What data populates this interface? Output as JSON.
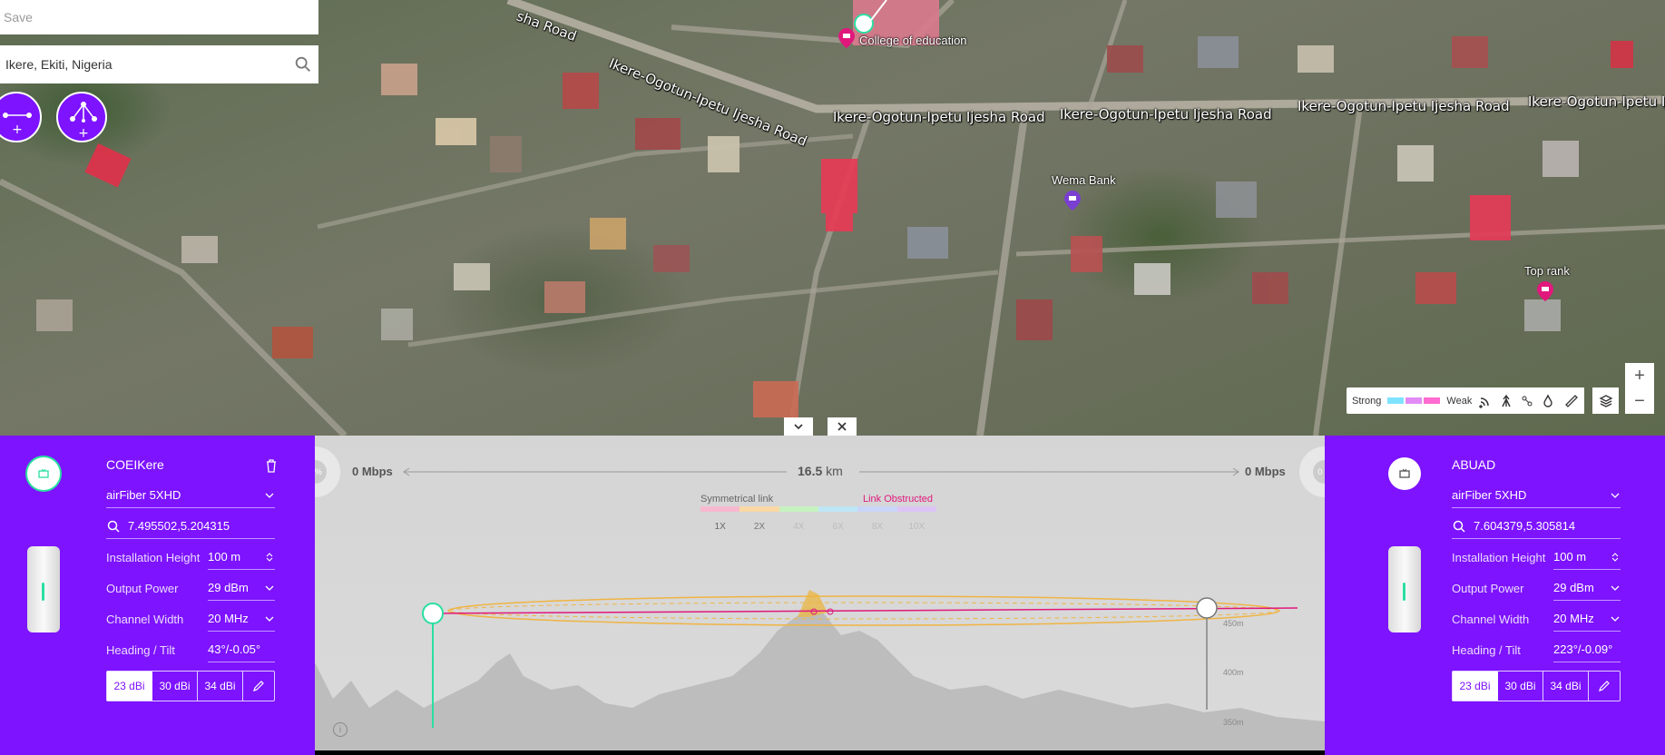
{
  "map": {
    "roads": [
      "Ikere-Ogotun-Ipetu Ijesha Road",
      "Ikere-Ogotun-Ipetu Ijesha Road",
      "Ikere-Ogotun-Ipetu Ijesha Road",
      "Ikere-Ogotun-Ipetu Ijesha Road",
      "Ikere-Ogotun-Ipetu Ijesha Road",
      "Ikere-Ogotun-Ipetu Ijesha Road",
      "sha Road"
    ],
    "pois": {
      "college": "College of education",
      "bank": "Wema Bank",
      "toprank": "Top rank"
    }
  },
  "toolbar": {
    "save_placeholder": "Save",
    "search_value": "Ikere, Ekiti, Nigeria"
  },
  "legend": {
    "strong": "Strong",
    "weak": "Weak",
    "colors": [
      "#7fe3ff",
      "#e28bf5",
      "#ff6bd0"
    ]
  },
  "zoom": {
    "in": "+",
    "out": "−"
  },
  "left_device": {
    "name": "COEIKere",
    "model": "airFiber 5XHD",
    "coords": "7.495502,5.204315",
    "fields": [
      {
        "label": "Installation Height",
        "value": "100 m"
      },
      {
        "label": "Output Power",
        "value": "29 dBm"
      },
      {
        "label": "Channel Width",
        "value": "20 MHz"
      },
      {
        "label": "Heading / Tilt",
        "value": "43°/-0.05°"
      }
    ],
    "antennas": [
      "23 dBi",
      "30 dBi",
      "34 dBi"
    ]
  },
  "right_device": {
    "name": "ABUAD",
    "model": "airFiber 5XHD",
    "coords": "7.604379,5.305814",
    "fields": [
      {
        "label": "Installation Height",
        "value": "100 m"
      },
      {
        "label": "Output Power",
        "value": "29 dBm"
      },
      {
        "label": "Channel Width",
        "value": "20 MHz"
      },
      {
        "label": "Heading / Tilt",
        "value": "223°/-0.09°"
      }
    ],
    "antennas": [
      "23 dBi",
      "30 dBi",
      "34 dBi"
    ]
  },
  "link": {
    "left_pct": "0 %",
    "right_pct": "0 %",
    "left_mbps": "0 Mbps",
    "right_mbps": "0 Mbps",
    "distance": "16.5",
    "distance_unit": "km",
    "symmetrical": "Symmetrical link",
    "status": "Link Obstructed",
    "bands": [
      "1X",
      "2X",
      "4X",
      "6X",
      "8X",
      "10X"
    ],
    "band_colors": [
      "#f6b9cf",
      "#f9d8a6",
      "#c7f2c0",
      "#bfe6f5",
      "#c9d5f8",
      "#dcc5f5"
    ],
    "altitudes": [
      "450m",
      "400m",
      "350m"
    ]
  }
}
